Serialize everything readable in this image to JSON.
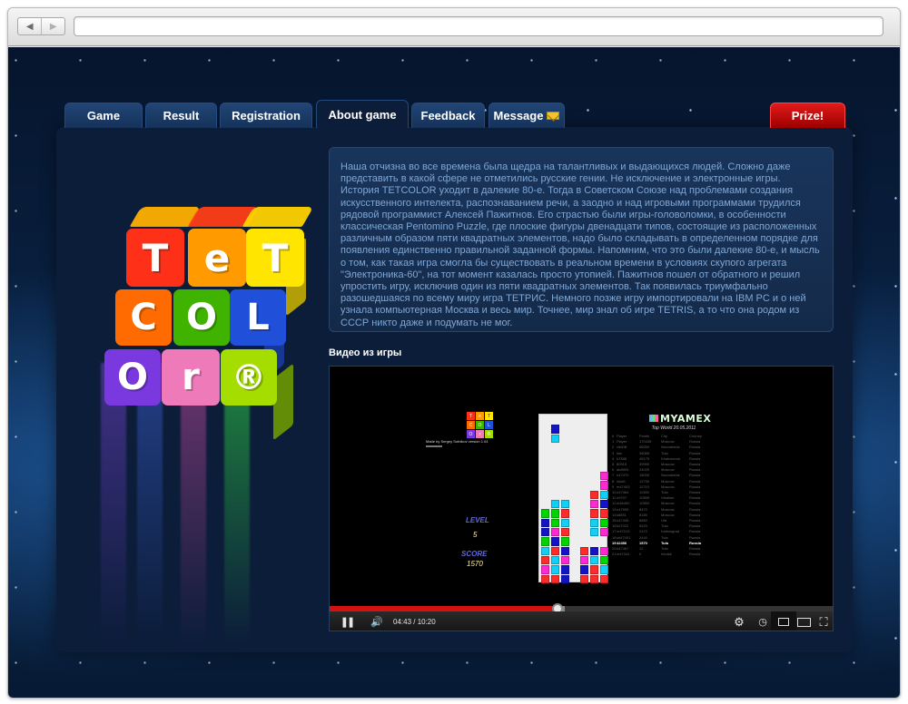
{
  "browser": {
    "back_icon": "back-icon",
    "forward_icon": "forward-icon",
    "back_symbol": "◀",
    "forward_symbol": "▶",
    "address": ""
  },
  "tabs": [
    {
      "label": "Game"
    },
    {
      "label": "Result"
    },
    {
      "label": "Registration"
    },
    {
      "label": "About game",
      "active": true
    },
    {
      "label": "Feedback"
    },
    {
      "label": "Message",
      "icon": "envelope-icon"
    },
    {
      "label": "Prize!"
    }
  ],
  "logo": {
    "letters": [
      "T",
      "e",
      "T",
      "C",
      "O",
      "L",
      "O",
      "r",
      "®"
    ]
  },
  "about": {
    "text": "Наша отчизна во все времена была щедра на талантливых и выдающихся людей. Сложно даже представить в какой сфере не отметились русские гении. Не исключение и электронные игры. История TETCOLOR уходит в далекие 80-е. Тогда в Советском Союзе над проблемами создания искусственного интелекта, распознаванием речи, а заодно и над игровыми программами трудился рядовой программист Алексей Пажитнов. Его страстью были игры-головоломки, в особенности классическая Pentomino Puzzle, где плоские фигуры двенадцати типов, состоящие из расположенных различным образом пяти квадратных элементов, надо было складывать в определенном порядке для появления единственно правильной заданной формы. Напомним, что это были далекие 80-е, и мысль о том, как такая игра смогла бы существовать в реальном времени в условиях скупого агрегата \"Электроника-60\", на тот момент казалась просто утопией. Пажитнов пошел от обратного  и решил упростить игру, исключив один из пяти квадратных элементов. Так появилась триумфально разошедшаяся по всему миру игра ТЕТРИС. Немного позже игру импортировали на IBM PC и о ней узнала компьютерная Москва и весь мир. Точнее, мир знал об игре TETRIS, а то что она родом из СССР никто даже и подумать не мог."
  },
  "video": {
    "title": "Видео из игры",
    "mini_logo": [
      "T",
      "e",
      "T",
      "C",
      "O",
      "L",
      "O",
      "r",
      "®"
    ],
    "credit": "Made by Sergey Sotnikov version 1.04",
    "level_label": "LEVEL",
    "level_value": "5",
    "score_label": "SCORE",
    "score_value": "1570",
    "brand": "MYAMEX",
    "top_world": "Top World 20.05.2011",
    "score_headers": [
      "Player",
      "Points",
      "City",
      "Country"
    ],
    "scores": [
      [
        "1",
        "Player",
        "170435",
        "Moscow",
        "Russia"
      ],
      [
        "2",
        "vikiDB",
        "96050",
        "Novosibirsk",
        "Russia"
      ],
      [
        "3",
        "lias",
        "36085",
        "Tula",
        "Russia"
      ],
      [
        "4",
        "k7388",
        "49175",
        "Khabarovsk",
        "Russia"
      ],
      [
        "5",
        "80915",
        "39990",
        "Moscow",
        "Russia"
      ],
      [
        "6",
        "ab8805",
        "24025",
        "Moscow",
        "Russia"
      ],
      [
        "7",
        "n47470",
        "18030",
        "Novosibirsk",
        "Russia"
      ],
      [
        "8",
        "nika5",
        "12790",
        "Moscow",
        "Russia"
      ],
      [
        "9",
        "m47403",
        "11710",
        "Moscow",
        "Russia"
      ],
      [
        "10",
        "n47464",
        "11380",
        "Tula",
        "Russia"
      ],
      [
        "11",
        "n9707",
        "10895",
        "Vladimir",
        "Russia"
      ],
      [
        "12",
        "m46450",
        "10550",
        "Moscow",
        "Russia"
      ],
      [
        "13",
        "n47505",
        "8470",
        "Moscow",
        "Russia"
      ],
      [
        "14",
        "k8851",
        "8180",
        "Moscow",
        "Russia"
      ],
      [
        "15",
        "n47445",
        "6850",
        "Ufa",
        "Russia"
      ],
      [
        "16",
        "k47022",
        "5420",
        "Tula",
        "Russia"
      ],
      [
        "17",
        "m47013",
        "2470",
        "Kaliningrad",
        "Russia"
      ],
      [
        "18",
        "sb47401",
        "2440",
        "Tula",
        "Russia"
      ],
      [
        "19",
        "42456",
        "1570",
        "Tula",
        "Russia"
      ],
      [
        "20",
        "n47467",
        "12",
        "Tula",
        "Russia"
      ],
      [
        "21",
        "m47441",
        "0",
        "Irkutsk",
        "Russia"
      ]
    ],
    "time": "04:43 / 10:20",
    "progress_fraction": 0.452,
    "buffer_fraction": 0.466,
    "board": {
      "columns": 7,
      "rows": 18,
      "cells": [
        [
          1,
          1,
          "#1313c8"
        ],
        [
          1,
          2,
          "#12d0f5"
        ],
        [
          1,
          9,
          "#12d0f5"
        ],
        [
          2,
          9,
          "#12d0f5"
        ],
        [
          0,
          10,
          "#00d500"
        ],
        [
          1,
          10,
          "#00d500"
        ],
        [
          2,
          10,
          "#ff2a2a"
        ],
        [
          0,
          11,
          "#1313c8"
        ],
        [
          1,
          11,
          "#00d500"
        ],
        [
          2,
          11,
          "#12d0f5"
        ],
        [
          0,
          12,
          "#1313c8"
        ],
        [
          1,
          12,
          "#ff28d2"
        ],
        [
          2,
          12,
          "#ff2a2a"
        ],
        [
          0,
          13,
          "#00d500"
        ],
        [
          1,
          13,
          "#1313c8"
        ],
        [
          2,
          13,
          "#00d500"
        ],
        [
          0,
          14,
          "#12d0f5"
        ],
        [
          1,
          14,
          "#ff2a2a"
        ],
        [
          2,
          14,
          "#1313c8"
        ],
        [
          0,
          15,
          "#ff2a2a"
        ],
        [
          1,
          15,
          "#12d0f5"
        ],
        [
          2,
          15,
          "#ff28d2"
        ],
        [
          0,
          16,
          "#ff28d2"
        ],
        [
          1,
          16,
          "#12d0f5"
        ],
        [
          2,
          16,
          "#1313c8"
        ],
        [
          0,
          17,
          "#ff2a2a"
        ],
        [
          1,
          17,
          "#ff2a2a"
        ],
        [
          2,
          17,
          "#1313c8"
        ],
        [
          6,
          6,
          "#ff28d2"
        ],
        [
          6,
          7,
          "#ff28d2"
        ],
        [
          5,
          8,
          "#ff2a2a"
        ],
        [
          6,
          8,
          "#12d0f5"
        ],
        [
          5,
          9,
          "#ff28d2"
        ],
        [
          6,
          9,
          "#1313c8"
        ],
        [
          5,
          10,
          "#ff2a2a"
        ],
        [
          6,
          10,
          "#ff2a2a"
        ],
        [
          5,
          11,
          "#12d0f5"
        ],
        [
          6,
          11,
          "#00d500"
        ],
        [
          5,
          12,
          "#12d0f5"
        ],
        [
          6,
          12,
          "#ff28d2"
        ],
        [
          4,
          14,
          "#ff2a2a"
        ],
        [
          5,
          14,
          "#1313c8"
        ],
        [
          6,
          14,
          "#ff28d2"
        ],
        [
          4,
          15,
          "#ff28d2"
        ],
        [
          5,
          15,
          "#12d0f5"
        ],
        [
          6,
          15,
          "#00d500"
        ],
        [
          4,
          16,
          "#1313c8"
        ],
        [
          5,
          16,
          "#ff2a2a"
        ],
        [
          6,
          16,
          "#12d0f5"
        ],
        [
          4,
          17,
          "#ff2a2a"
        ],
        [
          5,
          17,
          "#ff2a2a"
        ],
        [
          6,
          17,
          "#ff2a2a"
        ]
      ]
    }
  },
  "colors": {
    "accent_red": "#d41212",
    "tab_blue": "#153259",
    "prize_red": "#b00000",
    "text_blue": "#7fa7d5"
  }
}
